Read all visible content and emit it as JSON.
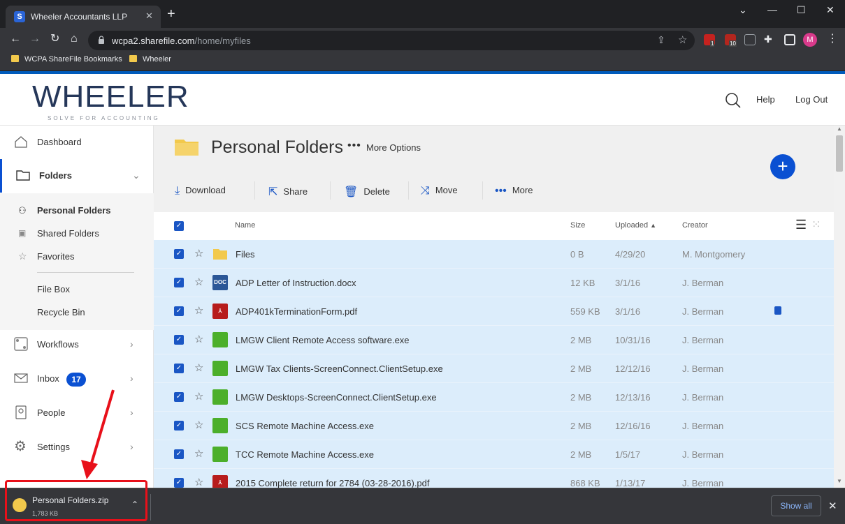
{
  "browser": {
    "tab_title": "Wheeler Accountants LLP",
    "tab_favicon": "S",
    "url_host": "wcpa2.sharefile.com",
    "url_path": "/home/myfiles",
    "bookmarks": [
      "WCPA ShareFile Bookmarks",
      "Wheeler"
    ],
    "profile_initial": "M",
    "ext_badge_1": "1",
    "ext_badge_2": "10"
  },
  "header": {
    "logo": "WHEELER",
    "logo_tagline": "SOLVE FOR ACCOUNTING",
    "help": "Help",
    "logout": "Log Out"
  },
  "sidebar": {
    "dashboard": "Dashboard",
    "folders": "Folders",
    "personal_folders": "Personal Folders",
    "shared_folders": "Shared Folders",
    "favorites": "Favorites",
    "file_box": "File Box",
    "recycle_bin": "Recycle Bin",
    "workflows": "Workflows",
    "inbox": "Inbox",
    "inbox_count": "17",
    "people": "People",
    "settings": "Settings"
  },
  "main": {
    "title": "Personal Folders",
    "more_options": "More Options",
    "actions": {
      "download": "Download",
      "share": "Share",
      "delete": "Delete",
      "move": "Move",
      "more": "More"
    },
    "columns": {
      "name": "Name",
      "size": "Size",
      "uploaded": "Uploaded",
      "creator": "Creator"
    },
    "files": [
      {
        "name": "Files",
        "size": "0 B",
        "uploaded": "4/29/20",
        "creator": "M. Montgomery",
        "type": "folder"
      },
      {
        "name": "ADP Letter of Instruction.docx",
        "size": "12 KB",
        "uploaded": "3/1/16",
        "creator": "J. Berman",
        "type": "doc"
      },
      {
        "name": "ADP401kTerminationForm.pdf",
        "size": "559 KB",
        "uploaded": "3/1/16",
        "creator": "J. Berman",
        "type": "pdf"
      },
      {
        "name": "LMGW Client Remote Access software.exe",
        "size": "2 MB",
        "uploaded": "10/31/16",
        "creator": "J. Berman",
        "type": "exe"
      },
      {
        "name": "LMGW Tax Clients-ScreenConnect.ClientSetup.exe",
        "size": "2 MB",
        "uploaded": "12/12/16",
        "creator": "J. Berman",
        "type": "exe"
      },
      {
        "name": "LMGW Desktops-ScreenConnect.ClientSetup.exe",
        "size": "2 MB",
        "uploaded": "12/13/16",
        "creator": "J. Berman",
        "type": "exe"
      },
      {
        "name": "SCS Remote Machine Access.exe",
        "size": "2 MB",
        "uploaded": "12/16/16",
        "creator": "J. Berman",
        "type": "exe"
      },
      {
        "name": "TCC Remote Machine Access.exe",
        "size": "2 MB",
        "uploaded": "1/5/17",
        "creator": "J. Berman",
        "type": "exe"
      },
      {
        "name": "2015 Complete return for 2784 (03-28-2016).pdf",
        "size": "868 KB",
        "uploaded": "1/13/17",
        "creator": "J. Berman",
        "type": "pdf"
      }
    ]
  },
  "download_shelf": {
    "filename": "Personal Folders.zip",
    "size": "1,783 KB",
    "show_all": "Show all"
  },
  "colors": {
    "accent": "#0a50d2",
    "row_selected": "#dcedfb",
    "annotation_red": "#e8101a"
  }
}
